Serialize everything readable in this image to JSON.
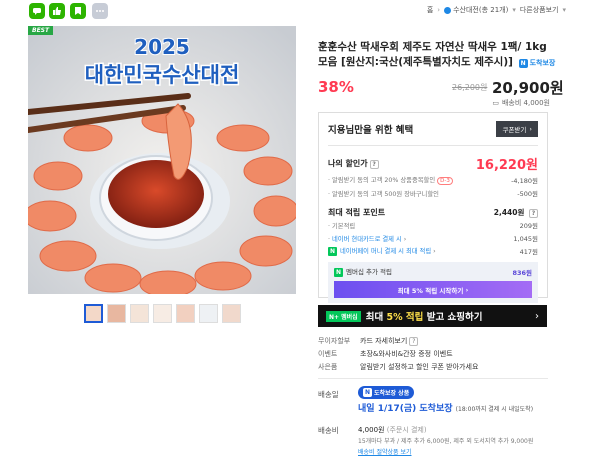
{
  "topbar": {
    "home": "홈",
    "store_name": "수산대전(총 21개)",
    "other": "다른상품보기"
  },
  "image": {
    "best_tag": "BEST",
    "banner_year": "2025",
    "banner_title": "대한민국수산대전"
  },
  "product": {
    "title": "훈훈수산 딱새우회 제주도 자연산 딱새우 1팩/ 1kg 모음 [원산지:국산(제주특별자치도 제주시)]",
    "delivery_badge": "도착보장",
    "discount": "38%",
    "original_price": "26,200원",
    "price": "20,900원",
    "shipping_fee_line": "배송비 4,000원"
  },
  "benefit": {
    "title": "지용님만을 위한 혜택",
    "coupon_btn": "쿠폰받기",
    "my_price_label": "나의 할인가",
    "my_price": "16,220원",
    "alarm_label": "알림받기 동의 고객 20% 상품중복할인",
    "alarm_pill": "D-3",
    "alarm_value": "-4,180원",
    "alarm2_label": "알림받기 동의 고객 500원 장바구니할인",
    "alarm2_value": "-500원",
    "points_label": "최대 적립 포인트",
    "points_value": "2,440원",
    "basic_label": "기본적립",
    "basic_value": "209원",
    "card_label": "네이버 현대카드로 결제 시",
    "card_value": "1,045원",
    "npay_label": "네이버페이 머니 결제 시 최대 적립",
    "npay_value": "417원",
    "member_label": "멤버십 추가 적립",
    "member_value": "836원",
    "member_btn": "최대 5% 적립 시작하기"
  },
  "membership_banner": {
    "badge": "N+ 멤버십",
    "text_pre": "최대 ",
    "text_hl": "5% 적립",
    "text_post": " 받고 쇼핑하기"
  },
  "info": {
    "interest_k": "무이자할부",
    "interest_v": "카드 자세히보기",
    "event_k": "이벤트",
    "event_v": "초장&와사비&간장 증정 이벤트",
    "gift_k": "사은품",
    "gift_v": "알림받기 설정하고 할인 쿠폰 받아가세요"
  },
  "shipping": {
    "method_k": "배송일",
    "pill": "도착보장 상품",
    "date": "내일 1/17(금) 도착보장",
    "date_note": "(18:00까지 결제 시 내일도착)",
    "fee_k": "배송비",
    "fee_v": "4,000원",
    "fee_v2": "(주문시 결제)",
    "fee_note": "15개마다 부과 / 제주 추가 6,000원, 제주 외 도서지역 추가 9,000원",
    "fee_link": "배송비 절약상품 보기"
  },
  "colors": {
    "accent_red": "#ff3a52",
    "brand_green": "#2db400",
    "naver_blue": "#1e88e5",
    "member_purple": "#6c4ff0"
  }
}
